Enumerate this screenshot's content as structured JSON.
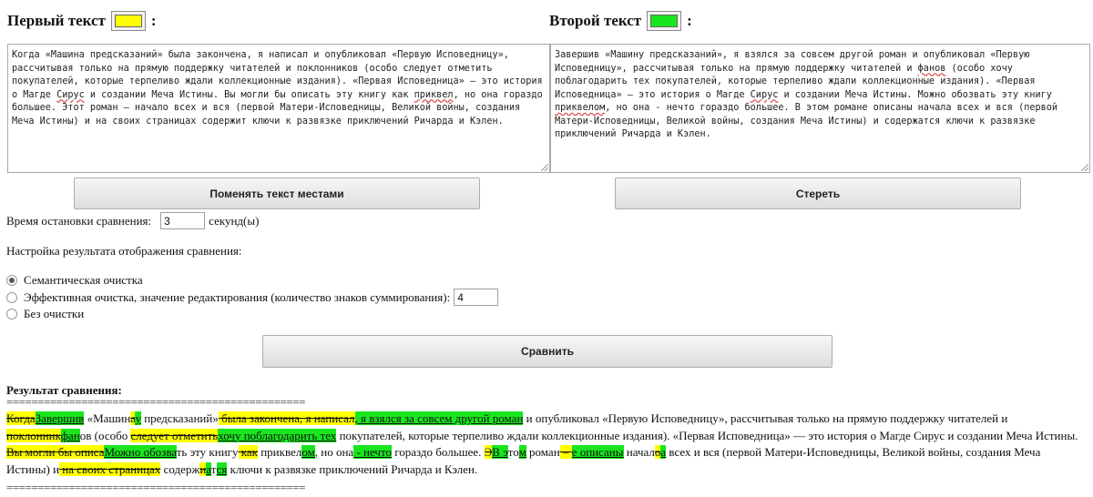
{
  "left_panel": {
    "title": "Первый текст",
    "suffix": ":",
    "swatch_color": "#ffff00",
    "text_parts": [
      "Когда «Машина предсказаний» была закончена, я написал и опубликовал «Первую Исповедницу», рассчитывая только на прямую поддержку читателей и поклонников (особо следует отметить покупателей, которые терпеливо ждали коллекционные издания). «Первая Исповедница» — это история о Магде ",
      "Сирус",
      " и создании Меча Истины. Вы могли бы описать эту книгу как ",
      "приквел",
      ", но она гораздо большее. Этот роман – начало всех и вся (первой Матери-Исповедницы, Великой войны, создания Меча Истины) и на своих страницах содержит ключи к развязке приключений Ричарда и Кэлен."
    ]
  },
  "right_panel": {
    "title": "Второй текст",
    "suffix": ":",
    "swatch_color": "#19e51e",
    "text_parts": [
      "Завершив «Машину предсказаний», я взялся за совсем другой роман и опубликовал «Первую Исповедницу», рассчитывая только на прямую поддержку читателей и ",
      "фанов",
      " (особо хочу поблагодарить тех покупателей, которые терпеливо ждали коллекционные издания). «Первая Исповедница» — это история о Магде ",
      "Сирус",
      " и создании Меча Истины. Можно обозвать эту книгу ",
      "приквелом",
      ", но она - нечто гораздо большее. В этом романе описаны начала всех и вся (первой Матери-Исповедницы, Великой войны, создания Меча Истины) и содержатся ключи к развязке приключений Ричарда и Кэлен."
    ]
  },
  "buttons": {
    "swap": "Поменять текст местами",
    "clear": "Стереть",
    "compare": "Сравнить"
  },
  "timeout": {
    "label": "Время остановки сравнения:",
    "value": "3",
    "unit": "секунд(ы)"
  },
  "settings": {
    "label": "Настройка результата отображения сравнения:",
    "options": [
      {
        "label": "Семантическая очистка",
        "checked": true
      },
      {
        "label": "Эффективная очистка, значение редактирования (количество знаков суммирования):",
        "checked": false,
        "value": "4"
      },
      {
        "label": "Без очистки",
        "checked": false
      }
    ]
  },
  "result": {
    "title": "Результат сравнения:",
    "separator": "================================================",
    "del_color": "#ffff00",
    "ins_color": "#19e51e",
    "segments": [
      {
        "t": "del",
        "s": "Когда"
      },
      {
        "t": "ins",
        "s": "Завершив"
      },
      {
        "t": "eq",
        "s": " «Машин"
      },
      {
        "t": "del",
        "s": "а"
      },
      {
        "t": "ins",
        "s": "у"
      },
      {
        "t": "eq",
        "s": " предсказаний»"
      },
      {
        "t": "del",
        "s": " была закончена, я написал"
      },
      {
        "t": "ins",
        "s": ", я взялся за совсем другой роман"
      },
      {
        "t": "eq",
        "s": " и опубликовал «Первую Исповедницу», рассчитывая только на прямую поддержку читателей и "
      },
      {
        "t": "del",
        "s": "поклонник"
      },
      {
        "t": "ins",
        "s": "фан"
      },
      {
        "t": "eq",
        "s": "ов (особо "
      },
      {
        "t": "del",
        "s": "следует отметить"
      },
      {
        "t": "ins",
        "s": "хочу поблагодарить тех"
      },
      {
        "t": "eq",
        "s": " покупателей, которые терпеливо ждали коллекционные издания). «Первая Исповедница» — это история о Магде Сирус и создании Меча Истины. "
      },
      {
        "t": "del",
        "s": "Вы могли бы описа"
      },
      {
        "t": "ins",
        "s": "Можно обозва"
      },
      {
        "t": "eq",
        "s": "ть эту книгу"
      },
      {
        "t": "del",
        "s": " как"
      },
      {
        "t": "eq",
        "s": " приквел"
      },
      {
        "t": "ins",
        "s": "ом"
      },
      {
        "t": "eq",
        "s": ", но она"
      },
      {
        "t": "ins",
        "s": " - нечто"
      },
      {
        "t": "eq",
        "s": " гораздо большее. "
      },
      {
        "t": "del",
        "s": "Э"
      },
      {
        "t": "ins",
        "s": "В э"
      },
      {
        "t": "eq",
        "s": "то"
      },
      {
        "t": "ins",
        "s": "м"
      },
      {
        "t": "eq",
        "s": " роман"
      },
      {
        "t": "del",
        "s": " – "
      },
      {
        "t": "ins",
        "s": "е описаны"
      },
      {
        "t": "eq",
        "s": " начал"
      },
      {
        "t": "del",
        "s": "о"
      },
      {
        "t": "ins",
        "s": "а"
      },
      {
        "t": "eq",
        "s": " всех и вся (первой Матери-Исповедницы, Великой войны, создания Меча Истины) и"
      },
      {
        "t": "del",
        "s": " на своих страницах"
      },
      {
        "t": "eq",
        "s": " содерж"
      },
      {
        "t": "del",
        "s": "и"
      },
      {
        "t": "ins",
        "s": "а"
      },
      {
        "t": "eq",
        "s": "т"
      },
      {
        "t": "ins",
        "s": "ся"
      },
      {
        "t": "eq",
        "s": " ключи к развязке приключений Ричарда и Кэлен."
      }
    ]
  }
}
